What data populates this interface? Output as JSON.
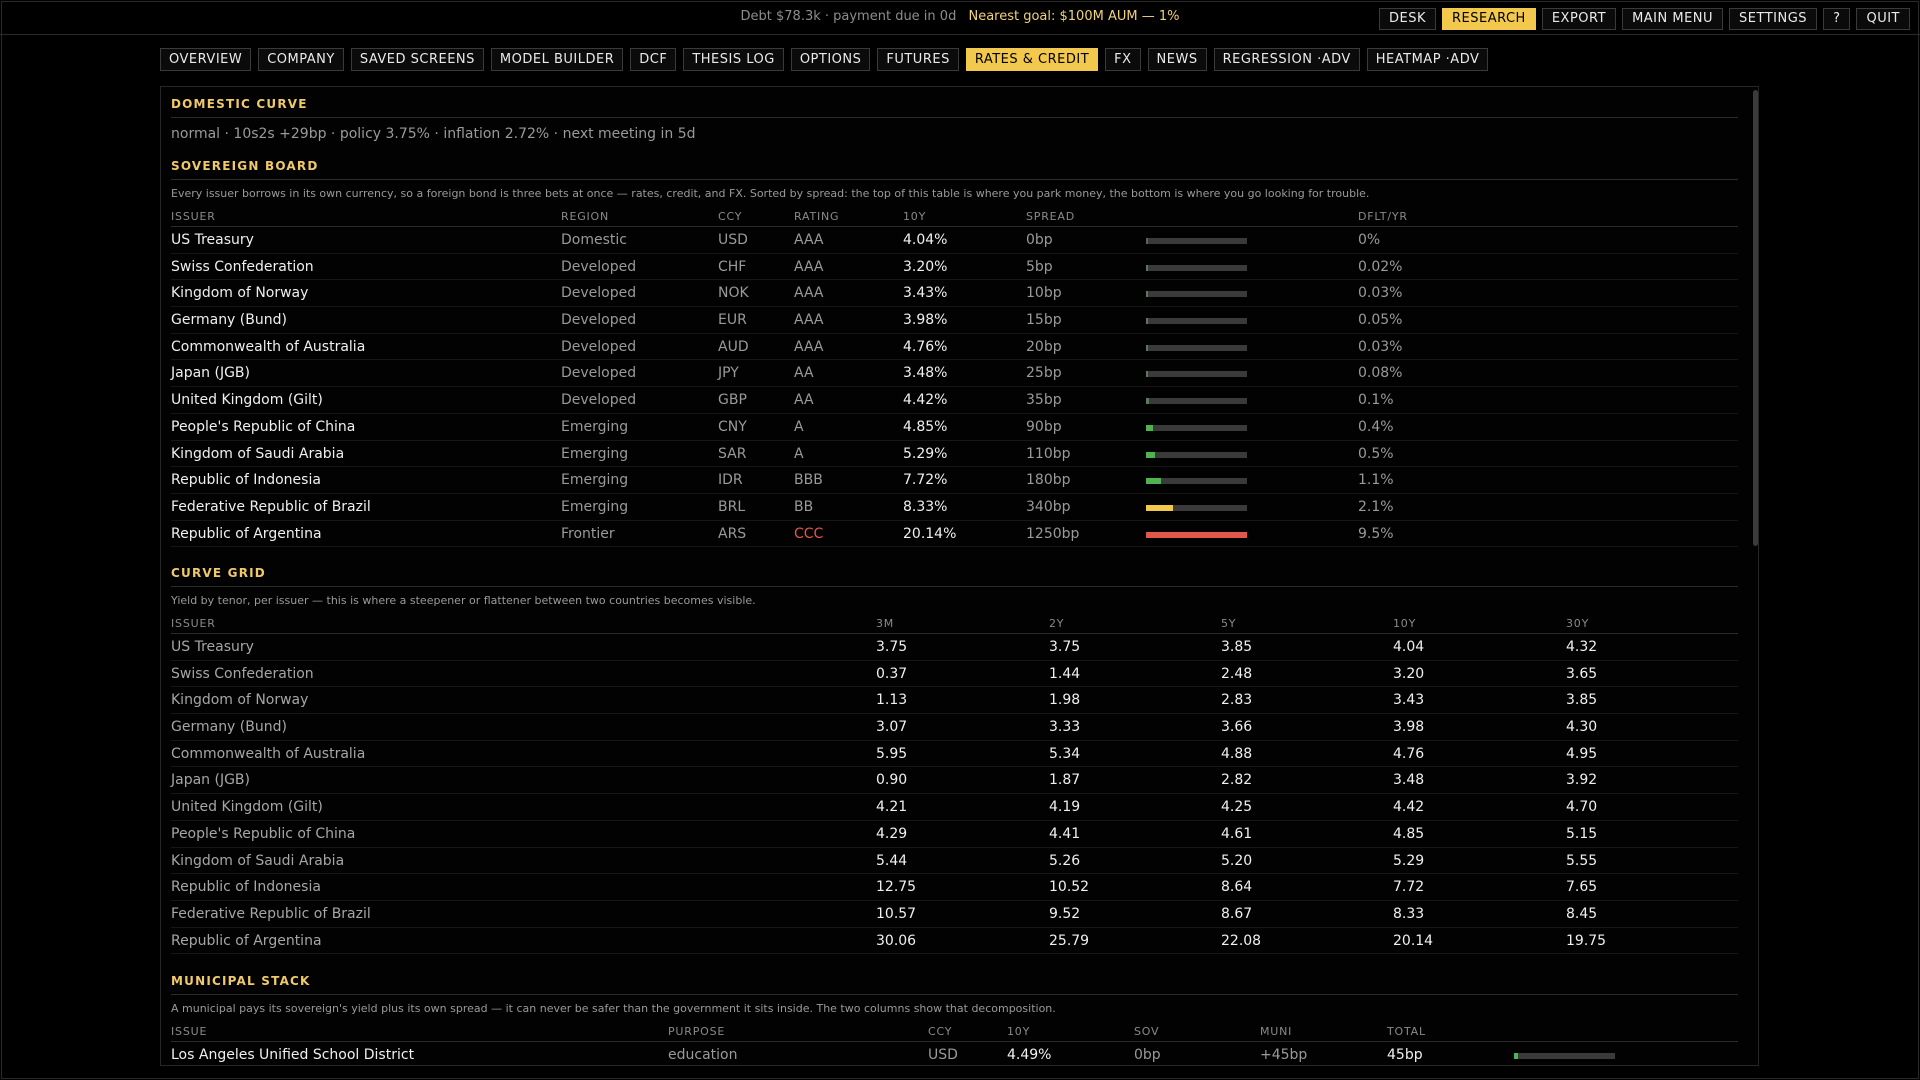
{
  "status": {
    "debt_text": "Debt $78.3k · payment due in 0d",
    "goal_text": "Nearest goal: $100M AUM — 1%"
  },
  "system_buttons": [
    {
      "label": "DESK",
      "active": false
    },
    {
      "label": "RESEARCH",
      "active": true
    },
    {
      "label": "EXPORT",
      "active": false
    },
    {
      "label": "MAIN MENU",
      "active": false
    },
    {
      "label": "SETTINGS",
      "active": false
    },
    {
      "label": "?",
      "active": false
    },
    {
      "label": "QUIT",
      "active": false
    }
  ],
  "tabs": [
    {
      "label": "OVERVIEW",
      "active": false
    },
    {
      "label": "COMPANY",
      "active": false
    },
    {
      "label": "SAVED SCREENS",
      "active": false
    },
    {
      "label": "MODEL BUILDER",
      "active": false
    },
    {
      "label": "DCF",
      "active": false
    },
    {
      "label": "THESIS LOG",
      "active": false
    },
    {
      "label": "OPTIONS",
      "active": false
    },
    {
      "label": "FUTURES",
      "active": false
    },
    {
      "label": "RATES & CREDIT",
      "active": true
    },
    {
      "label": "FX",
      "active": false
    },
    {
      "label": "NEWS",
      "active": false
    },
    {
      "label": "REGRESSION ·ADV",
      "active": false
    },
    {
      "label": "HEATMAP ·ADV",
      "active": false
    }
  ],
  "domestic_curve": {
    "title": "DOMESTIC CURVE",
    "summary": "normal · 10s2s +29bp · policy 3.75% · inflation 2.72% · next meeting in 5d"
  },
  "sovereign_board": {
    "title": "SOVEREIGN BOARD",
    "note": "Every issuer borrows in its own currency, so a foreign bond is three bets at once — rates, credit, and FX. Sorted by spread: the top of this table is where you park money, the bottom is where you go looking for trouble.",
    "headers": [
      "ISSUER",
      "REGION",
      "CCY",
      "RATING",
      "10Y",
      "SPREAD",
      "",
      "DFLT/YR"
    ],
    "colors": {
      "low": "#4fb34f",
      "mid": "#f2c94c",
      "high": "#e0584a",
      "track": "#3a3a3a"
    },
    "rows": [
      {
        "issuer": "US Treasury",
        "region": "Domestic",
        "ccy": "USD",
        "rating": "AAA",
        "y10": "4.04%",
        "spread": "0bp",
        "spread_bp": 0,
        "dflt": "0%"
      },
      {
        "issuer": "Swiss Confederation",
        "region": "Developed",
        "ccy": "CHF",
        "rating": "AAA",
        "y10": "3.20%",
        "spread": "5bp",
        "spread_bp": 5,
        "dflt": "0.02%"
      },
      {
        "issuer": "Kingdom of Norway",
        "region": "Developed",
        "ccy": "NOK",
        "rating": "AAA",
        "y10": "3.43%",
        "spread": "10bp",
        "spread_bp": 10,
        "dflt": "0.03%"
      },
      {
        "issuer": "Germany (Bund)",
        "region": "Developed",
        "ccy": "EUR",
        "rating": "AAA",
        "y10": "3.98%",
        "spread": "15bp",
        "spread_bp": 15,
        "dflt": "0.05%"
      },
      {
        "issuer": "Commonwealth of Australia",
        "region": "Developed",
        "ccy": "AUD",
        "rating": "AAA",
        "y10": "4.76%",
        "spread": "20bp",
        "spread_bp": 20,
        "dflt": "0.03%"
      },
      {
        "issuer": "Japan (JGB)",
        "region": "Developed",
        "ccy": "JPY",
        "rating": "AA",
        "y10": "3.48%",
        "spread": "25bp",
        "spread_bp": 25,
        "dflt": "0.08%"
      },
      {
        "issuer": "United Kingdom (Gilt)",
        "region": "Developed",
        "ccy": "GBP",
        "rating": "AA",
        "y10": "4.42%",
        "spread": "35bp",
        "spread_bp": 35,
        "dflt": "0.1%"
      },
      {
        "issuer": "People's Republic of China",
        "region": "Emerging",
        "ccy": "CNY",
        "rating": "A",
        "y10": "4.85%",
        "spread": "90bp",
        "spread_bp": 90,
        "dflt": "0.4%"
      },
      {
        "issuer": "Kingdom of Saudi Arabia",
        "region": "Emerging",
        "ccy": "SAR",
        "rating": "A",
        "y10": "5.29%",
        "spread": "110bp",
        "spread_bp": 110,
        "dflt": "0.5%"
      },
      {
        "issuer": "Republic of Indonesia",
        "region": "Emerging",
        "ccy": "IDR",
        "rating": "BBB",
        "y10": "7.72%",
        "spread": "180bp",
        "spread_bp": 180,
        "dflt": "1.1%"
      },
      {
        "issuer": "Federative Republic of Brazil",
        "region": "Emerging",
        "ccy": "BRL",
        "rating": "BB",
        "y10": "8.33%",
        "spread": "340bp",
        "spread_bp": 340,
        "dflt": "2.1%"
      },
      {
        "issuer": "Republic of Argentina",
        "region": "Frontier",
        "ccy": "ARS",
        "rating": "CCC",
        "y10": "20.14%",
        "spread": "1250bp",
        "spread_bp": 1250,
        "dflt": "9.5%"
      }
    ]
  },
  "curve_grid": {
    "title": "CURVE GRID",
    "note": "Yield by tenor, per issuer — this is where a steepener or flattener between two countries becomes visible.",
    "headers": [
      "ISSUER",
      "3M",
      "2Y",
      "5Y",
      "10Y",
      "30Y"
    ],
    "rows": [
      {
        "issuer": "US Treasury",
        "vals": [
          "3.75",
          "3.75",
          "3.85",
          "4.04",
          "4.32"
        ]
      },
      {
        "issuer": "Swiss Confederation",
        "vals": [
          "0.37",
          "1.44",
          "2.48",
          "3.20",
          "3.65"
        ]
      },
      {
        "issuer": "Kingdom of Norway",
        "vals": [
          "1.13",
          "1.98",
          "2.83",
          "3.43",
          "3.85"
        ]
      },
      {
        "issuer": "Germany (Bund)",
        "vals": [
          "3.07",
          "3.33",
          "3.66",
          "3.98",
          "4.30"
        ]
      },
      {
        "issuer": "Commonwealth of Australia",
        "vals": [
          "5.95",
          "5.34",
          "4.88",
          "4.76",
          "4.95"
        ]
      },
      {
        "issuer": "Japan (JGB)",
        "vals": [
          "0.90",
          "1.87",
          "2.82",
          "3.48",
          "3.92"
        ]
      },
      {
        "issuer": "United Kingdom (Gilt)",
        "vals": [
          "4.21",
          "4.19",
          "4.25",
          "4.42",
          "4.70"
        ]
      },
      {
        "issuer": "People's Republic of China",
        "vals": [
          "4.29",
          "4.41",
          "4.61",
          "4.85",
          "5.15"
        ]
      },
      {
        "issuer": "Kingdom of Saudi Arabia",
        "vals": [
          "5.44",
          "5.26",
          "5.20",
          "5.29",
          "5.55"
        ]
      },
      {
        "issuer": "Republic of Indonesia",
        "vals": [
          "12.75",
          "10.52",
          "8.64",
          "7.72",
          "7.65"
        ]
      },
      {
        "issuer": "Federative Republic of Brazil",
        "vals": [
          "10.57",
          "9.52",
          "8.67",
          "8.33",
          "8.45"
        ]
      },
      {
        "issuer": "Republic of Argentina",
        "vals": [
          "30.06",
          "25.79",
          "22.08",
          "20.14",
          "19.75"
        ]
      }
    ]
  },
  "municipal_stack": {
    "title": "MUNICIPAL STACK",
    "note": "A municipal pays its sovereign's yield plus its own spread — it can never be safer than the government it sits inside. The two columns show that decomposition.",
    "headers": [
      "ISSUE",
      "PURPOSE",
      "CCY",
      "10Y",
      "SOV",
      "MUNI",
      "TOTAL",
      ""
    ],
    "rows": [
      {
        "issue": "Los Angeles Unified School District",
        "purpose": "education",
        "ccy": "USD",
        "y10": "4.49%",
        "sov": "0bp",
        "muni": "+45bp",
        "total": "45bp",
        "total_bp": 45
      }
    ]
  }
}
